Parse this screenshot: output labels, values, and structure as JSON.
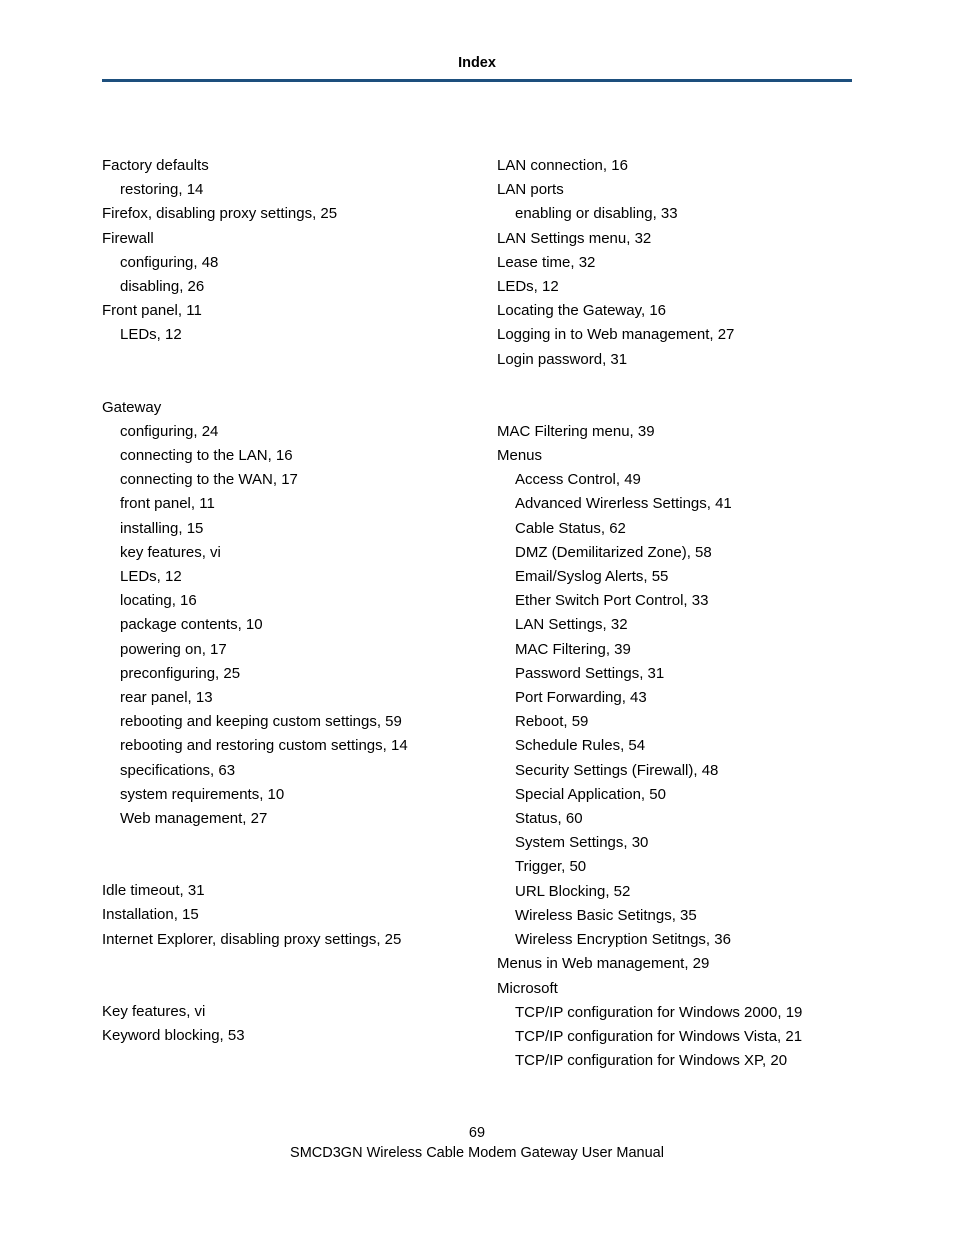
{
  "header": "Index",
  "footer": {
    "pageNum": "69",
    "manual": "SMCD3GN Wireless Cable Modem Gateway User Manual"
  },
  "left": [
    {
      "t": "Factory defaults",
      "cls": "entry"
    },
    {
      "t": "restoring, 14",
      "cls": "entry sub"
    },
    {
      "t": "Firefox, disabling proxy settings, 25",
      "cls": "entry"
    },
    {
      "t": "Firewall",
      "cls": "entry"
    },
    {
      "t": "configuring, 48",
      "cls": "entry sub"
    },
    {
      "t": "disabling, 26",
      "cls": "entry sub"
    },
    {
      "t": "Front panel, 11",
      "cls": "entry"
    },
    {
      "t": "LEDs, 12",
      "cls": "entry sub"
    },
    {
      "t": "Gateway",
      "cls": "entry group-gap"
    },
    {
      "t": "configuring, 24",
      "cls": "entry sub"
    },
    {
      "t": "connecting to the LAN, 16",
      "cls": "entry sub"
    },
    {
      "t": "connecting to the WAN, 17",
      "cls": "entry sub"
    },
    {
      "t": "front panel, 11",
      "cls": "entry sub"
    },
    {
      "t": "installing, 15",
      "cls": "entry sub"
    },
    {
      "t": "key features, vi",
      "cls": "entry sub"
    },
    {
      "t": "LEDs, 12",
      "cls": "entry sub"
    },
    {
      "t": "locating, 16",
      "cls": "entry sub"
    },
    {
      "t": "package contents, 10",
      "cls": "entry sub"
    },
    {
      "t": "powering on, 17",
      "cls": "entry sub"
    },
    {
      "t": "preconfiguring, 25",
      "cls": "entry sub"
    },
    {
      "t": "rear panel, 13",
      "cls": "entry sub"
    },
    {
      "t": "rebooting and keeping custom settings, 59",
      "cls": "entry sub"
    },
    {
      "t": "rebooting and restoring custom settings, 14",
      "cls": "entry sub"
    },
    {
      "t": "specifications, 63",
      "cls": "entry sub"
    },
    {
      "t": "system requirements, 10",
      "cls": "entry sub"
    },
    {
      "t": "Web management, 27",
      "cls": "entry sub"
    },
    {
      "t": "Idle timeout, 31",
      "cls": "entry group-gap"
    },
    {
      "t": "Installation, 15",
      "cls": "entry"
    },
    {
      "t": "Internet Explorer, disabling proxy settings, 25",
      "cls": "entry"
    },
    {
      "t": "Key features, vi",
      "cls": "entry group-gap"
    },
    {
      "t": "Keyword blocking, 53",
      "cls": "entry"
    }
  ],
  "right": [
    {
      "t": "LAN connection, 16",
      "cls": "entry"
    },
    {
      "t": "LAN ports",
      "cls": "entry"
    },
    {
      "t": "enabling or disabling, 33",
      "cls": "entry sub"
    },
    {
      "t": "LAN Settings menu, 32",
      "cls": "entry"
    },
    {
      "t": "Lease time, 32",
      "cls": "entry"
    },
    {
      "t": "LEDs, 12",
      "cls": "entry"
    },
    {
      "t": "Locating the Gateway, 16",
      "cls": "entry"
    },
    {
      "t": "Logging in to Web management, 27",
      "cls": "entry"
    },
    {
      "t": "Login password, 31",
      "cls": "entry"
    },
    {
      "t": "MAC Filtering menu, 39",
      "cls": "entry group-gap"
    },
    {
      "t": "Menus",
      "cls": "entry"
    },
    {
      "t": "Access Control, 49",
      "cls": "entry sub"
    },
    {
      "t": "Advanced Wirerless Settings, 41",
      "cls": "entry sub"
    },
    {
      "t": "Cable Status, 62",
      "cls": "entry sub"
    },
    {
      "t": "DMZ (Demilitarized Zone), 58",
      "cls": "entry sub"
    },
    {
      "t": "Email/Syslog Alerts, 55",
      "cls": "entry sub"
    },
    {
      "t": "Ether Switch Port Control, 33",
      "cls": "entry sub"
    },
    {
      "t": "LAN Settings, 32",
      "cls": "entry sub"
    },
    {
      "t": "MAC Filtering, 39",
      "cls": "entry sub"
    },
    {
      "t": "Password Settings, 31",
      "cls": "entry sub"
    },
    {
      "t": "Port Forwarding, 43",
      "cls": "entry sub"
    },
    {
      "t": "Reboot, 59",
      "cls": "entry sub"
    },
    {
      "t": "Schedule Rules, 54",
      "cls": "entry sub"
    },
    {
      "t": "Security Settings (Firewall), 48",
      "cls": "entry sub"
    },
    {
      "t": "Special Application, 50",
      "cls": "entry sub"
    },
    {
      "t": "Status, 60",
      "cls": "entry sub"
    },
    {
      "t": "System Settings, 30",
      "cls": "entry sub"
    },
    {
      "t": "Trigger, 50",
      "cls": "entry sub"
    },
    {
      "t": "URL Blocking, 52",
      "cls": "entry sub"
    },
    {
      "t": "Wireless Basic Setitngs, 35",
      "cls": "entry sub"
    },
    {
      "t": "Wireless Encryption Setitngs, 36",
      "cls": "entry sub"
    },
    {
      "t": "Menus in Web management, 29",
      "cls": "entry"
    },
    {
      "t": "Microsoft",
      "cls": "entry"
    },
    {
      "t": "TCP/IP configuration for Windows 2000, 19",
      "cls": "entry sub"
    },
    {
      "t": "TCP/IP configuration for Windows Vista, 21",
      "cls": "entry sub"
    },
    {
      "t": "TCP/IP configuration for Windows XP, 20",
      "cls": "entry sub"
    }
  ]
}
